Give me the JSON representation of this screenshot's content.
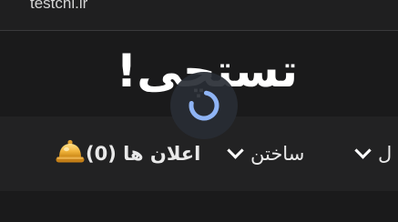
{
  "browser": {
    "url_text": "testchi.ir"
  },
  "header": {
    "logo_text": "تستچی!"
  },
  "nav": {
    "notifications_label": "اعلان ها (0)",
    "build_label": "ساختن",
    "more_label": "ل"
  },
  "icons": {
    "notifications": "bell-icon",
    "dropdown": "chevron-down-icon",
    "loading": "loading-spinner-icon"
  },
  "colors": {
    "page_background": "#1a1a1b",
    "nav_background": "#222223",
    "spinner_accent": "#8fb4f5",
    "bell_gold": "#e9a531"
  }
}
